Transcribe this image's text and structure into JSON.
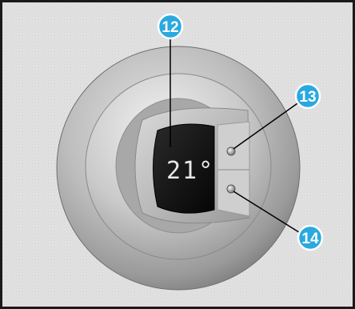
{
  "display": {
    "temperature_text": "21°"
  },
  "callouts": [
    {
      "id": "12",
      "label": "12",
      "target": "temperature-display"
    },
    {
      "id": "13",
      "label": "13",
      "target": "upper-button"
    },
    {
      "id": "14",
      "label": "14",
      "target": "lower-button"
    }
  ],
  "colors": {
    "callout_fill": "#29a9e0",
    "callout_stroke": "#ffffff",
    "frame": "#1a1a1a",
    "background": "#e1e1e1",
    "display_screen": "#111111"
  }
}
